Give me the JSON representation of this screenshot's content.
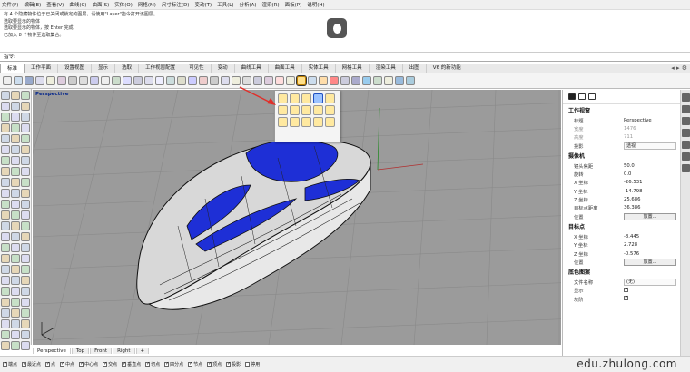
{
  "menu": [
    "文件(F)",
    "编辑(E)",
    "查看(V)",
    "曲线(C)",
    "曲面(S)",
    "实体(O)",
    "网格(M)",
    "尺寸标注(D)",
    "变动(T)",
    "工具(L)",
    "分析(A)",
    "渲染(R)",
    "面板(P)",
    "说明(H)"
  ],
  "history": [
    "有 4 个隐藏物件位于已关闭或锁定的图层，请使用\"Layer\"指令打开该图层。",
    "选取要显示的物体",
    "选取要显示的物体，按 Enter 完成",
    "已加入 8 个物件至选取集合。"
  ],
  "command": {
    "label": "指令:"
  },
  "tabs": [
    "标准",
    "工作平面",
    "设置视图",
    "显示",
    "选取",
    "工作视窗配置",
    "可见性",
    "变动",
    "曲线工具",
    "曲面工具",
    "实体工具",
    "网格工具",
    "渲染工具",
    "出图",
    "V6 的新功能"
  ],
  "viewport": {
    "name": "Perspective"
  },
  "viewport_tabs": [
    "Perspective",
    "Top",
    "Front",
    "Right"
  ],
  "panel": {
    "section_view": "工作视窗",
    "title_label": "标题",
    "title_value": "Perspective",
    "width_label": "宽度",
    "width_value": "1476",
    "height_label": "高度",
    "height_value": "711",
    "projection_label": "投影",
    "projection_value": "透视",
    "section_camera": "摄像机",
    "lens_label": "镜头焦距",
    "lens_value": "50.0",
    "rotation_label": "旋转",
    "rotation_value": "0.0",
    "cx_label": "X 坐标",
    "cx_value": "-26.531",
    "cy_label": "Y 坐标",
    "cy_value": "-14.798",
    "cz_label": "Z 坐标",
    "cz_value": "25.686",
    "dist_label": "目标点距离",
    "dist_value": "36.386",
    "pos_label": "位置",
    "place_button": "放置...",
    "section_target": "目标点",
    "tx_label": "X 坐标",
    "tx_value": "-8.445",
    "ty_label": "Y 坐标",
    "ty_value": "2.728",
    "tz_label": "Z 坐标",
    "tz_value": "-0.576",
    "tpos_label": "位置",
    "tplace_button": "放置...",
    "section_wallpaper": "底色图案",
    "file_label": "文件名称",
    "file_value": "(无)",
    "show_label": "显示",
    "gray_label": "灰阶"
  },
  "status": [
    "端点",
    "最近点",
    "点",
    "中点",
    "中心点",
    "交点",
    "垂直点",
    "切点",
    "四分点",
    "节点",
    "顶点",
    "投影",
    "停用"
  ],
  "watermark": "edu.zhulong.com",
  "colors": {
    "viewport_bg": "#9b9b9b",
    "model_blue": "#1e2fd6",
    "accent": "#e0302a"
  }
}
